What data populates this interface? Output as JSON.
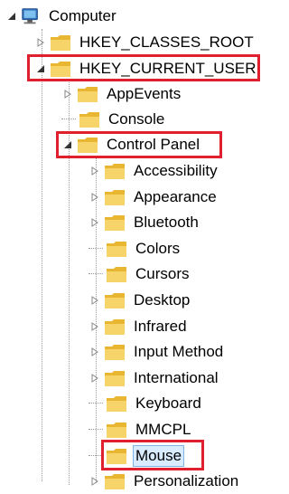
{
  "tree": {
    "root": {
      "label": "Computer",
      "icon": "computer-icon"
    },
    "hkcr": {
      "label": "HKEY_CLASSES_ROOT",
      "icon": "folder-icon"
    },
    "hkcu": {
      "label": "HKEY_CURRENT_USER",
      "icon": "folder-icon"
    },
    "appevents": {
      "label": "AppEvents"
    },
    "console": {
      "label": "Console"
    },
    "control_panel": {
      "label": "Control Panel"
    },
    "items": [
      {
        "label": "Accessibility",
        "expandable": true
      },
      {
        "label": "Appearance",
        "expandable": true
      },
      {
        "label": "Bluetooth",
        "expandable": true
      },
      {
        "label": "Colors",
        "expandable": false
      },
      {
        "label": "Cursors",
        "expandable": false
      },
      {
        "label": "Desktop",
        "expandable": true
      },
      {
        "label": "Infrared",
        "expandable": true
      },
      {
        "label": "Input Method",
        "expandable": true
      },
      {
        "label": "International",
        "expandable": true
      },
      {
        "label": "Keyboard",
        "expandable": false
      },
      {
        "label": "MMCPL",
        "expandable": false
      },
      {
        "label": "Mouse",
        "expandable": false,
        "selected": true
      },
      {
        "label": "Personalization",
        "expandable": true
      }
    ]
  },
  "colors": {
    "highlight_box": "#e0202e",
    "folder_body": "#f2c94c",
    "selection": "#d9ecff"
  }
}
